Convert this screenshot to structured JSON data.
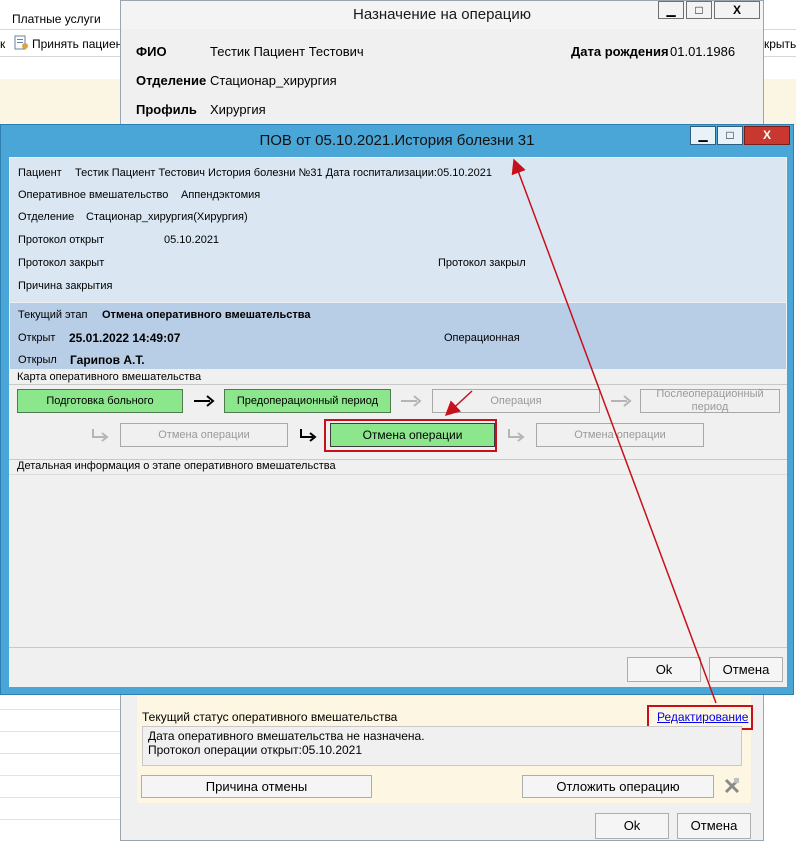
{
  "background_app": {
    "tab_label": "Платные услуги",
    "toolbar_left_fragment": "к",
    "toolbar_accept_label": "Принять пациен",
    "toolbar_right_fragment": "крыть"
  },
  "back_dialog": {
    "title": "Назначение на операцию",
    "window_buttons": {
      "minimize": "▁",
      "maximize": "□",
      "close": "X"
    },
    "fio_label": "ФИО",
    "fio_value": "Тестик Пациент Тестович",
    "birth_label": "Дата рождения",
    "birth_value": "01.01.1986",
    "department_label": "Отделение",
    "department_value": "Стационар_хирургия",
    "profile_label": "Профиль",
    "profile_value": "Хирургия",
    "status_title": "Текущий статус оперативного вмешательства",
    "edit_link": "Редактирование",
    "status_line1": "Дата оперативного вмешательства не назначена.",
    "status_line2": "Протокол операции открыт:05.10.2021",
    "cancel_reason_button": "Причина отмены",
    "postpone_button": "Отложить операцию",
    "ok_button": "Ok",
    "cancel_button": "Отмена"
  },
  "front_dialog": {
    "title": "ПОВ от 05.10.2021.История болезни 31",
    "window_buttons": {
      "minimize": "▁",
      "maximize": "□",
      "close": "X"
    },
    "patient_label": "Пациент",
    "patient_value": "Тестик Пациент Тестович История болезни №31 Дата госпитализации:05.10.2021",
    "intervention_label": "Оперативное вмешательство",
    "intervention_value": "Аппендэктомия",
    "department_label": "Отделение",
    "department_value": "Стационар_хирургия(Хирургия)",
    "protocol_opened_label": "Протокол открыт",
    "protocol_opened_value": "05.10.2021",
    "protocol_closed_label": "Протокол закрыт",
    "protocol_closed_by_label": "Протокол закрыл",
    "close_reason_label": "Причина закрытия",
    "current_stage_label": "Текущий этап",
    "current_stage_value": "Отмена оперативного вмешательства",
    "opened_label": "Открыт",
    "opened_value": "25.01.2022 14:49:07",
    "opened_by_label": "Открыл",
    "opened_by_value": "Гарипов А.Т.",
    "stage_type_value": "Операционная",
    "map_title": "Карта оперативного вмешательства",
    "stages_row1": [
      "Подготовка больного",
      "Предоперационный период",
      "Операция",
      "Послеоперационный период"
    ],
    "stages_row2": [
      "Отмена операции",
      "Отмена операции",
      "Отмена операции"
    ],
    "details_title": "Детальная информация о этапе оперативного вмешательства",
    "ok_button": "Ok",
    "cancel_button": "Отмена"
  },
  "colors": {
    "front_title_bar": "#4aa6d6",
    "info_panel": "#dae7f3",
    "stage_panel": "#b8cde6",
    "stage_done": "#8ce68c",
    "close_button": "#c8382f",
    "annotation_red": "#c8101c",
    "link": "#0000ee"
  }
}
